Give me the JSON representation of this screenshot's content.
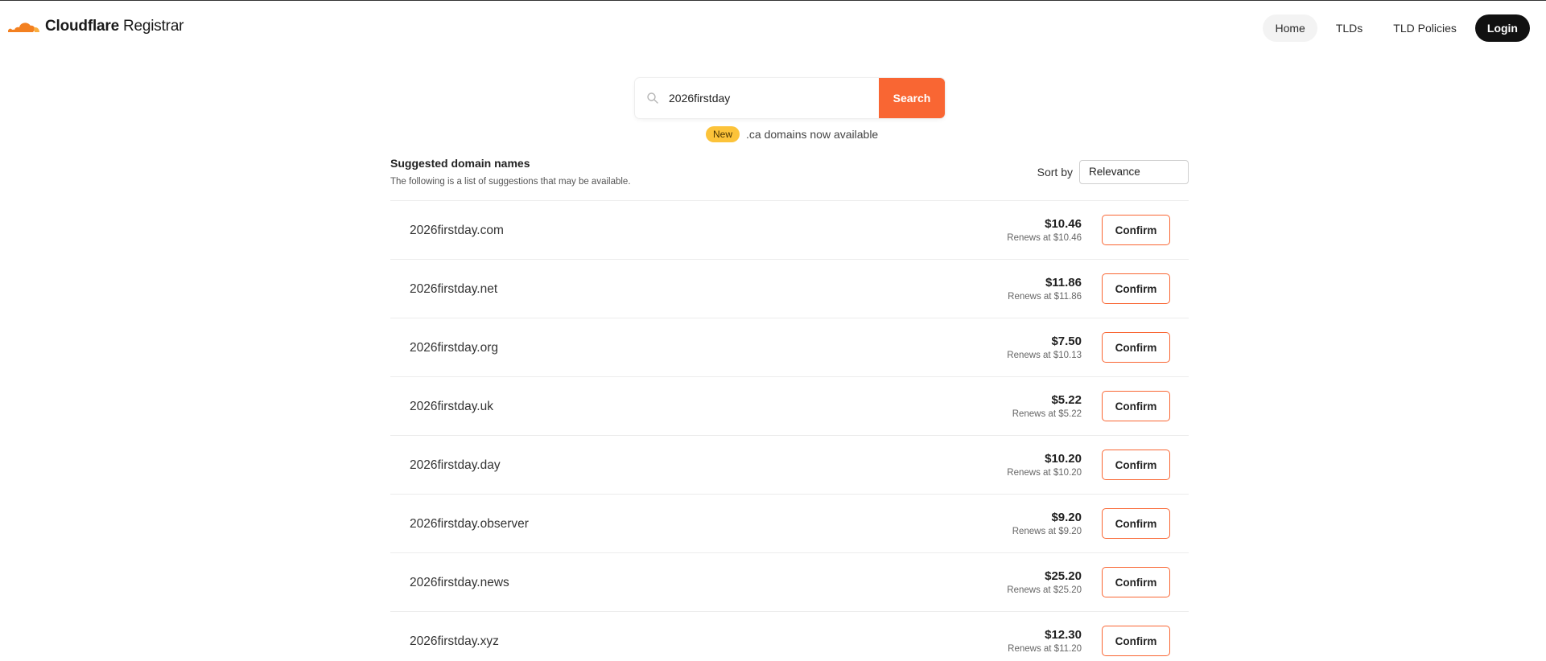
{
  "header": {
    "brand": "Cloudflare",
    "product": " Registrar",
    "nav": {
      "home": "Home",
      "tlds": "TLDs",
      "tld_policies": "TLD Policies",
      "login": "Login"
    }
  },
  "search": {
    "query": "2026firstday",
    "button_label": "Search"
  },
  "announcement": {
    "badge": "New",
    "text": ".ca domains now available"
  },
  "results": {
    "title": "Suggested domain names",
    "subtitle": "The following is a list of suggestions that may be available.",
    "sort_label": "Sort by",
    "sort_value": "Relevance",
    "confirm_label": "Confirm",
    "items": [
      {
        "domain": "2026firstday.com",
        "price": "$10.46",
        "renews": "Renews at $10.46"
      },
      {
        "domain": "2026firstday.net",
        "price": "$11.86",
        "renews": "Renews at $11.86"
      },
      {
        "domain": "2026firstday.org",
        "price": "$7.50",
        "renews": "Renews at $10.13"
      },
      {
        "domain": "2026firstday.uk",
        "price": "$5.22",
        "renews": "Renews at $5.22"
      },
      {
        "domain": "2026firstday.day",
        "price": "$10.20",
        "renews": "Renews at $10.20"
      },
      {
        "domain": "2026firstday.observer",
        "price": "$9.20",
        "renews": "Renews at $9.20"
      },
      {
        "domain": "2026firstday.news",
        "price": "$25.20",
        "renews": "Renews at $25.20"
      },
      {
        "domain": "2026firstday.xyz",
        "price": "$12.30",
        "renews": "Renews at $11.20"
      }
    ]
  },
  "colors": {
    "accent": "#f96633",
    "badge": "#fcc33a",
    "login_bg": "#111111"
  },
  "icons": {
    "logo": "cloudflare-cloud-logo-icon",
    "search": "search-icon"
  }
}
